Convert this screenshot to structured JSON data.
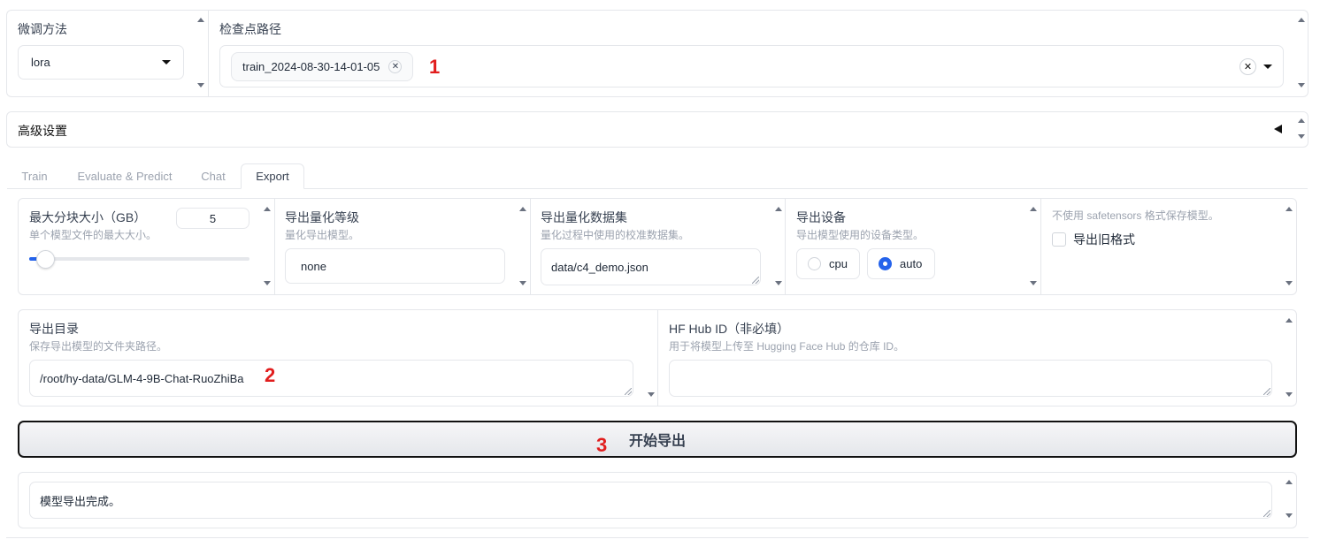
{
  "finetune": {
    "label": "微调方法",
    "value": "lora"
  },
  "checkpoint": {
    "label": "检查点路径",
    "tag": "train_2024-08-30-14-01-05"
  },
  "advanced": {
    "label": "高级设置"
  },
  "tabs": [
    {
      "label": "Train"
    },
    {
      "label": "Evaluate & Predict"
    },
    {
      "label": "Chat"
    },
    {
      "label": "Export"
    }
  ],
  "export": {
    "max_shard": {
      "label": "最大分块大小（GB）",
      "hint": "单个模型文件的最大大小。",
      "value": "5",
      "slider_fraction": 0.04
    },
    "quant_bit": {
      "label": "导出量化等级",
      "hint": "量化导出模型。",
      "value": "none"
    },
    "quant_dataset": {
      "label": "导出量化数据集",
      "hint": "量化过程中使用的校准数据集。",
      "value": "data/c4_demo.json"
    },
    "device": {
      "label": "导出设备",
      "hint": "导出模型使用的设备类型。",
      "options": [
        "cpu",
        "auto"
      ],
      "selected": "auto"
    },
    "legacy": {
      "hint": "不使用 safetensors 格式保存模型。",
      "label": "导出旧格式",
      "checked": false
    },
    "export_dir": {
      "label": "导出目录",
      "hint": "保存导出模型的文件夹路径。",
      "value": "/root/hy-data/GLM-4-9B-Chat-RuoZhiBa"
    },
    "hub_id": {
      "label": "HF Hub ID（非必填）",
      "hint": "用于将模型上传至 Hugging Face Hub 的仓库 ID。",
      "value": ""
    },
    "start_button": "开始导出",
    "output": "模型导出完成。"
  },
  "annotations": [
    "1",
    "2",
    "3"
  ]
}
